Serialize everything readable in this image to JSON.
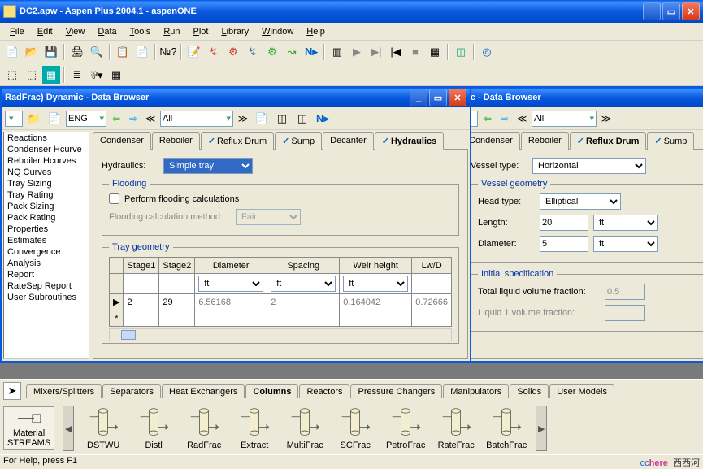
{
  "app": {
    "title": "DC2.apw - Aspen Plus 2004.1 - aspenONE"
  },
  "menu": [
    "File",
    "Edit",
    "View",
    "Data",
    "Tools",
    "Run",
    "Plot",
    "Library",
    "Window",
    "Help"
  ],
  "child1": {
    "title": "RadFrac) Dynamic - Data Browser",
    "units": "ENG",
    "filter": "All",
    "tree": [
      "Reactions",
      "Condenser Hcurve",
      "Reboiler Hcurves",
      "NQ Curves",
      "Tray Sizing",
      "Tray Rating",
      "Pack Sizing",
      "Pack Rating",
      "Properties",
      "Estimates",
      "Convergence",
      "Analysis",
      "Report",
      "RateSep Report",
      "User Subroutines"
    ],
    "tabs": [
      "Condenser",
      "Reboiler",
      "Reflux Drum",
      "Sump",
      "Decanter",
      "Hydraulics"
    ],
    "tabChecks": [
      false,
      false,
      true,
      true,
      false,
      true
    ],
    "activeTab": 5,
    "hydraulics": {
      "label": "Hydraulics:",
      "value": "Simple tray"
    },
    "flooding": {
      "legend": "Flooding",
      "cbLabel": "Perform flooding calculations",
      "cbChecked": false,
      "methodLabel": "Flooding calculation method:",
      "methodValue": "Fair"
    },
    "trayGeom": {
      "legend": "Tray geometry",
      "cols": [
        "Stage1",
        "Stage2",
        "Diameter",
        "Spacing",
        "Weir height",
        "Lw/D"
      ],
      "units": [
        "",
        "",
        "ft",
        "ft",
        "ft",
        ""
      ],
      "row": [
        "2",
        "29",
        "6.56168",
        "2",
        "0.164042",
        "0.72666"
      ]
    }
  },
  "child2": {
    "title": "mic - Data Browser",
    "filter": "All",
    "tabs": [
      "Condenser",
      "Reboiler",
      "Reflux Drum",
      "Sump"
    ],
    "tabChecks": [
      false,
      false,
      true,
      true
    ],
    "activeTab": 2,
    "vessel": {
      "typeLabel": "Vessel type:",
      "typeValue": "Horizontal",
      "geomLegend": "Vessel geometry",
      "headLabel": "Head type:",
      "headValue": "Elliptical",
      "lengthLabel": "Length:",
      "lengthValue": "20",
      "lengthUnit": "ft",
      "diamLabel": "Diameter:",
      "diamValue": "5",
      "diamUnit": "ft"
    },
    "initspec": {
      "legend": "Initial specification",
      "tlvfLabel": "Total liquid volume fraction:",
      "tlvfValue": "0.5",
      "l1vfLabel": "Liquid 1 volume fraction:"
    }
  },
  "palette": {
    "tabs": [
      "Mixers/Splitters",
      "Separators",
      "Heat Exchangers",
      "Columns",
      "Reactors",
      "Pressure Changers",
      "Manipulators",
      "Solids",
      "User Models"
    ],
    "activeTab": 3,
    "material": "Material",
    "streams": "STREAMS",
    "items": [
      "DSTWU",
      "Distl",
      "RadFrac",
      "Extract",
      "MultiFrac",
      "SCFrac",
      "PetroFrac",
      "RateFrac",
      "BatchFrac"
    ]
  },
  "status": {
    "help": "For Help, press F1",
    "wm1a": "cc",
    "wm1b": "here",
    "wm2": "西西河"
  }
}
